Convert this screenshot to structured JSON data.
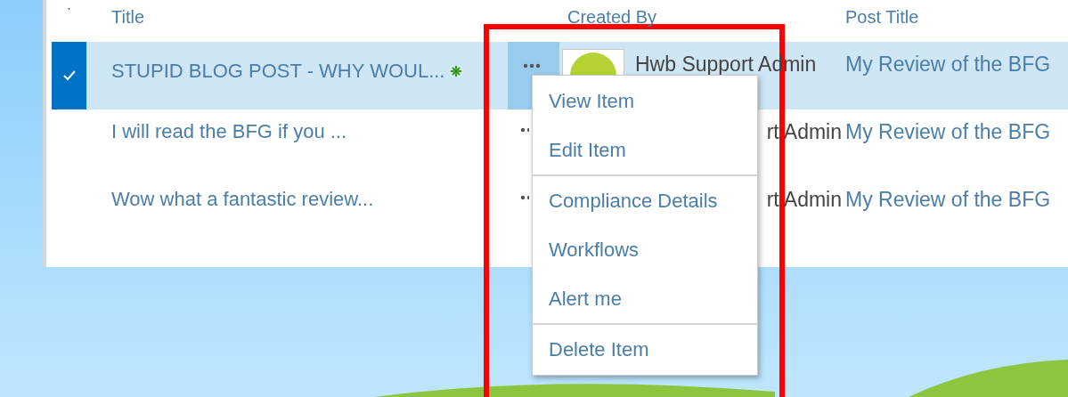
{
  "table": {
    "columns": [
      {
        "label": "ˑ"
      },
      {
        "label": "Title"
      },
      {},
      {
        "label": "Created By"
      },
      {
        "label": "Post Title"
      }
    ],
    "rows": [
      {
        "selected": true,
        "checked": true,
        "title": "STUPID BLOG POST - WHY WOUL...",
        "new": true,
        "created_by": "Hwb Support Admin",
        "avatar": true,
        "post_title": "My Review of the BFG"
      },
      {
        "selected": false,
        "checked": false,
        "title": "I will read the BFG if you ...",
        "new": false,
        "created_by": "rt Admin",
        "avatar": false,
        "post_title": "My Review of the BFG"
      },
      {
        "selected": false,
        "checked": false,
        "title": "Wow what a fantastic review...",
        "new": false,
        "created_by": "rt Admin",
        "avatar": false,
        "post_title": "My Review of the BFG"
      }
    ]
  },
  "context_menu": {
    "sections": [
      {
        "items": [
          "View Item",
          "Edit Item"
        ]
      },
      {
        "items": [
          "Compliance Details",
          "Workflows",
          "Alert me"
        ]
      },
      {
        "items": [
          "Delete Item"
        ]
      }
    ]
  }
}
